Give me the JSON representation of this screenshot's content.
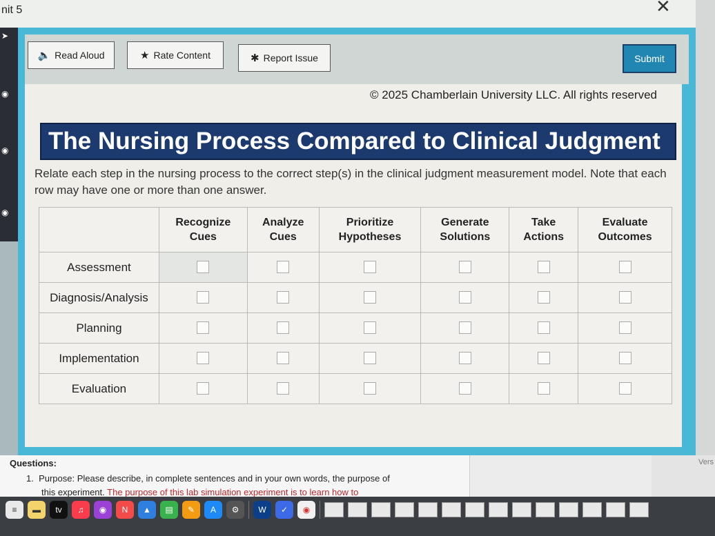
{
  "window": {
    "unit_label": "nit 5",
    "close_glyph": "✕"
  },
  "toolbar": {
    "read_aloud_label": "Read Aloud",
    "rate_content_label": "Rate Content",
    "report_issue_label": "Report Issue",
    "submit_label": "Submit",
    "icons": {
      "read_aloud": "speaker-icon",
      "rate_content": "star-icon",
      "report_issue": "bug-icon"
    }
  },
  "content": {
    "copyright": "© 2025 Chamberlain University LLC. All rights reserved",
    "title": "The Nursing Process Compared to Clinical Judgment",
    "instructions": "Relate each step in the nursing process to the correct step(s) in the clinical judgment measurement model. Note that each row may have one or more than one answer.",
    "columns": [
      {
        "line1": "Recognize",
        "line2": "Cues"
      },
      {
        "line1": "Analyze",
        "line2": "Cues"
      },
      {
        "line1": "Prioritize",
        "line2": "Hypotheses"
      },
      {
        "line1": "Generate",
        "line2": "Solutions"
      },
      {
        "line1": "Take",
        "line2": "Actions"
      },
      {
        "line1": "Evaluate",
        "line2": "Outcomes"
      }
    ],
    "rows": [
      {
        "label": "Assessment",
        "checked": [
          false,
          false,
          false,
          false,
          false,
          false
        ]
      },
      {
        "label": "Diagnosis/Analysis",
        "checked": [
          false,
          false,
          false,
          false,
          false,
          false
        ]
      },
      {
        "label": "Planning",
        "checked": [
          false,
          false,
          false,
          false,
          false,
          false
        ]
      },
      {
        "label": "Implementation",
        "checked": [
          false,
          false,
          false,
          false,
          false,
          false
        ]
      },
      {
        "label": "Evaluation",
        "checked": [
          false,
          false,
          false,
          false,
          false,
          false
        ]
      }
    ]
  },
  "document": {
    "questions_label": "Questions:",
    "item1_prefix": "1.",
    "item1_text": "Purpose: Please describe, in complete sentences and in your own words, the purpose of",
    "item1_continued": "this experiment.",
    "item1_answer": "The purpose of this lab simulation experiment is to learn how to",
    "version_label": "Vers"
  },
  "colors": {
    "frame": "#49b8d6",
    "title_bg": "#1d3a6f",
    "submit_bg": "#2286b3",
    "answer_red": "#c0282d"
  }
}
